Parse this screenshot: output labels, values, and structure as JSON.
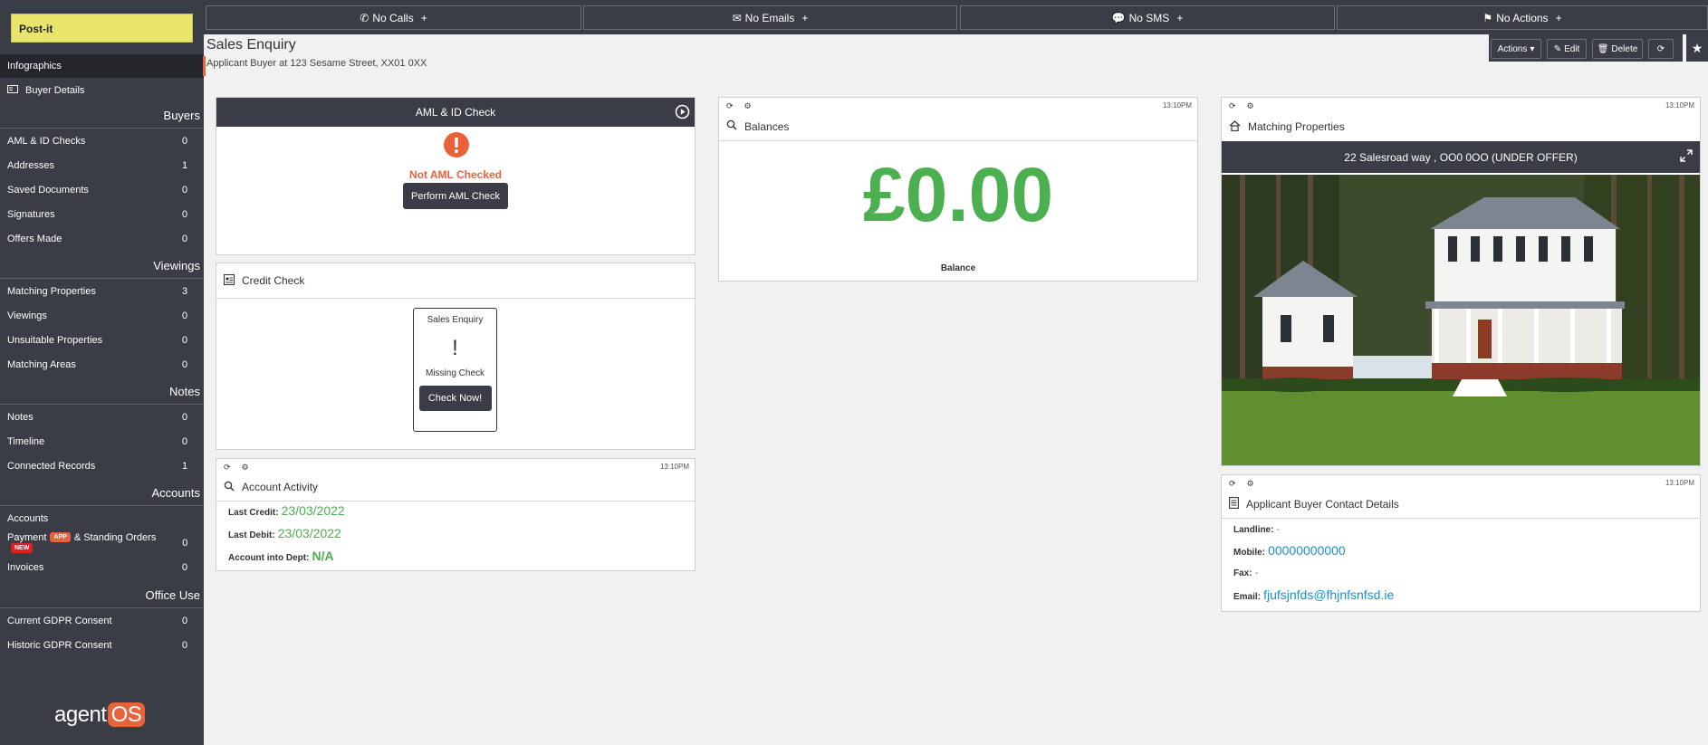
{
  "sidebar": {
    "postit": "Post-it",
    "active": "Infographics",
    "buyer_details": "Buyer Details",
    "sections": [
      {
        "head": "Buyers",
        "items": [
          {
            "label": "AML & ID Checks",
            "count": "0"
          },
          {
            "label": "Addresses",
            "count": "1"
          },
          {
            "label": "Saved Documents",
            "count": "0"
          },
          {
            "label": "Signatures",
            "count": "0"
          },
          {
            "label": "Offers Made",
            "count": "0"
          }
        ]
      },
      {
        "head": "Viewings",
        "items": [
          {
            "label": "Matching Properties",
            "count": "3"
          },
          {
            "label": "Viewings",
            "count": "0"
          },
          {
            "label": "Unsuitable Properties",
            "count": "0"
          },
          {
            "label": "Matching Areas",
            "count": "0"
          }
        ]
      },
      {
        "head": "Notes",
        "items": [
          {
            "label": "Notes",
            "count": "0"
          },
          {
            "label": "Timeline",
            "count": "0"
          },
          {
            "label": "Connected Records",
            "count": "1"
          }
        ]
      },
      {
        "head": "Accounts",
        "items": [
          {
            "label": "Accounts",
            "count": ""
          },
          {
            "label": "Payment",
            "badge1": "APP",
            "label2": "& Standing Orders",
            "badge2": "NEW",
            "count": "0"
          },
          {
            "label": "Invoices",
            "count": "0"
          }
        ]
      },
      {
        "head": "Office Use",
        "items": [
          {
            "label": "Current GDPR Consent",
            "count": "0"
          },
          {
            "label": "Historic GDPR Consent",
            "count": "0"
          }
        ]
      }
    ],
    "logo_main": "agent",
    "logo_os": "OS"
  },
  "topbar": {
    "calls": "No Calls",
    "emails": "No Emails",
    "sms": "No SMS",
    "actions": "No Actions",
    "plus": "+"
  },
  "header": {
    "title": "Sales Enquiry",
    "subtitle": "Applicant Buyer at 123 Sesame Street, XX01 0XX",
    "actions_btn": "Actions",
    "edit_btn": "Edit",
    "delete_btn": "Delete"
  },
  "aml": {
    "title": "AML & ID Check",
    "status": "Not AML Checked",
    "button": "Perform AML Check",
    "status_color": "#e8623a"
  },
  "credit": {
    "title": "Credit Check",
    "card_title": "Sales Enquiry",
    "mark": "!",
    "card_status": "Missing Check",
    "button": "Check Now!"
  },
  "activity": {
    "time": "13:10PM",
    "title": "Account Activity",
    "rows": [
      {
        "label": "Last Credit:",
        "value": "23/03/2022"
      },
      {
        "label": "Last Debit:",
        "value": "23/03/2022"
      },
      {
        "label": "Account into Dept:",
        "value": "N/A"
      }
    ]
  },
  "balances": {
    "time": "13:10PM",
    "title": "Balances",
    "amount": "£0.00",
    "caption": "Balance"
  },
  "matching": {
    "time": "13:10PM",
    "title": "Matching Properties",
    "property": "22 Salesroad way , OO0 0OO (UNDER OFFER)"
  },
  "contact": {
    "time": "13:10PM",
    "title": "Applicant Buyer Contact Details",
    "landline_label": "Landline:",
    "landline": "-",
    "mobile_label": "Mobile:",
    "mobile": "00000000000",
    "fax_label": "Fax:",
    "fax": "-",
    "email_label": "Email:",
    "email": "fjufsjnfds@fhjnfsnfsd.ie"
  }
}
